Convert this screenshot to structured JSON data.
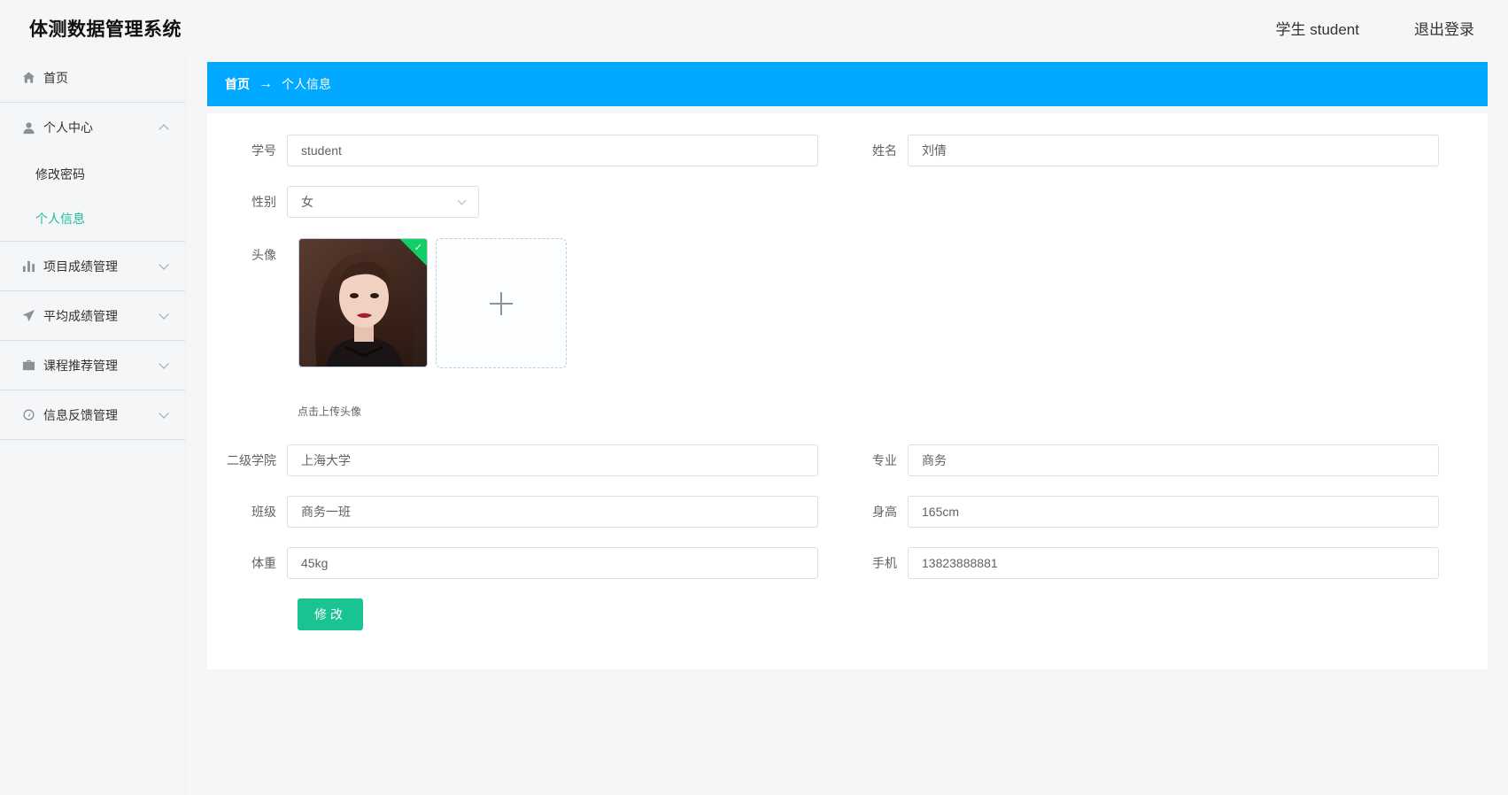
{
  "header": {
    "app_title": "体测数据管理系统",
    "user_label": "学生 student",
    "logout_label": "退出登录"
  },
  "sidebar": {
    "home_label": "首页",
    "personal_center": {
      "label": "个人中心",
      "expanded": true,
      "items": [
        {
          "label": "修改密码",
          "active": false
        },
        {
          "label": "个人信息",
          "active": true
        }
      ]
    },
    "groups": [
      {
        "label": "项目成绩管理",
        "icon": "bar-chart-icon"
      },
      {
        "label": "平均成绩管理",
        "icon": "paper-plane-icon"
      },
      {
        "label": "课程推荐管理",
        "icon": "briefcase-icon"
      },
      {
        "label": "信息反馈管理",
        "icon": "gauge-icon"
      }
    ]
  },
  "breadcrumb": {
    "home": "首页",
    "separator": "→",
    "current": "个人信息"
  },
  "form": {
    "student_id": {
      "label": "学号",
      "value": "student"
    },
    "name": {
      "label": "姓名",
      "value": "刘倩"
    },
    "gender": {
      "label": "性别",
      "value": "女"
    },
    "avatar": {
      "label": "头像",
      "upload_tip": "点击上传头像"
    },
    "college": {
      "label": "二级学院",
      "value": "上海大学"
    },
    "major": {
      "label": "专业",
      "value": "商务"
    },
    "class": {
      "label": "班级",
      "value": "商务一班"
    },
    "height": {
      "label": "身高",
      "value": "165cm"
    },
    "weight": {
      "label": "体重",
      "value": "45kg"
    },
    "phone": {
      "label": "手机",
      "value": "13823888881"
    },
    "submit_label": "修改"
  },
  "colors": {
    "breadcrumb_bg": "#00a8ff",
    "accent_green": "#19c392",
    "active_menu": "#19be9b"
  }
}
